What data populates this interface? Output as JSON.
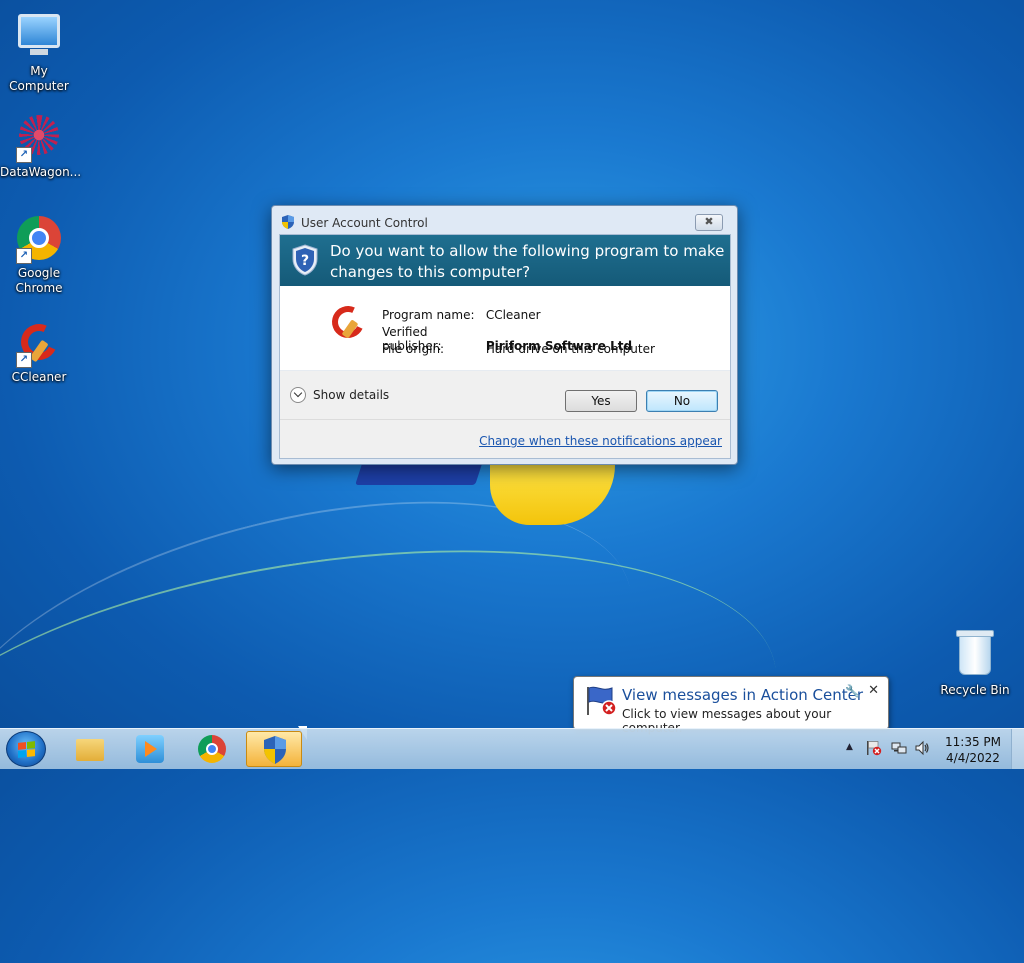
{
  "desktop": {
    "icons": [
      {
        "label": "My Computer"
      },
      {
        "label": "DataWagon..."
      },
      {
        "label": "Google Chrome"
      },
      {
        "label": "CCleaner"
      },
      {
        "label": "Recycle Bin"
      }
    ]
  },
  "uac_dialog": {
    "title": "User Account Control",
    "close_symbol": "✖",
    "question": "Do you want to allow the following program to make changes to this computer?",
    "program_name_label": "Program name:",
    "program_name": "CCleaner",
    "publisher_label": "Verified publisher:",
    "publisher": "Piriform Software Ltd",
    "origin_label": "File origin:",
    "origin": "Hard drive on this computer",
    "show_details": "Show details",
    "yes_label": "Yes",
    "no_label": "No",
    "notifications_link": "Change when these notifications appear"
  },
  "balloon": {
    "title": "View messages in Action Center",
    "text": "Click to view messages about your computer.",
    "close_symbol": "✕"
  },
  "taskbar": {
    "pinned": [
      "folder-icon",
      "media-player-icon",
      "chrome-icon",
      "uac-shield-icon"
    ],
    "clock_time": "11:35 PM",
    "clock_date": "4/4/2022"
  },
  "colors": {
    "uac_banner": "#1f6f90",
    "link": "#1a56b0",
    "balloon_title": "#1a4f9c",
    "active_taskbar_button": "#f4b33b"
  }
}
